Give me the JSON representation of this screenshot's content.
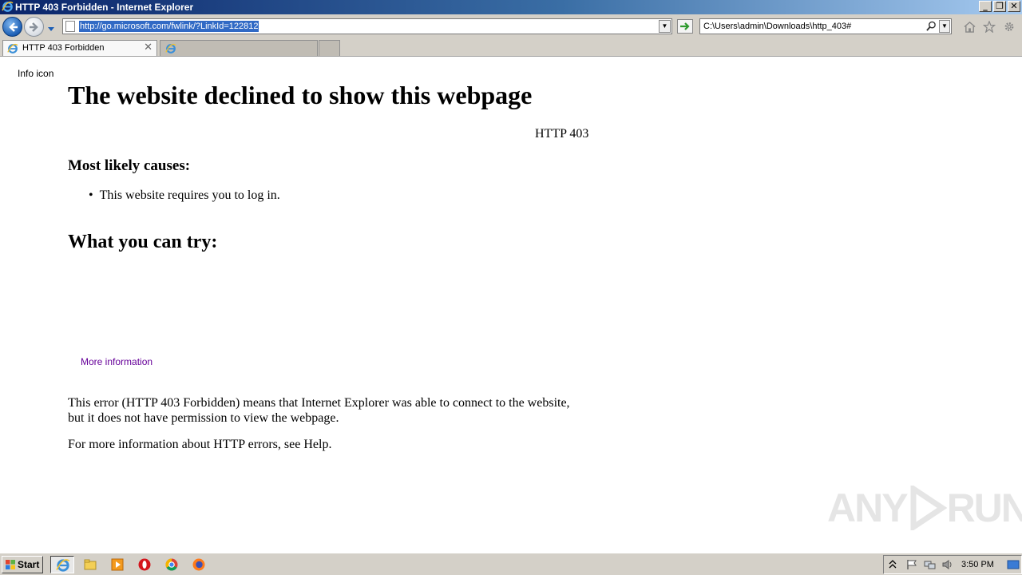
{
  "window": {
    "title": "HTTP 403 Forbidden - Internet Explorer",
    "controls": {
      "minimize": "_",
      "maximize": "❐",
      "close": "✕"
    }
  },
  "nav": {
    "url": "http://go.microsoft.com/fwlink/?LinkId=122812",
    "search_value": "C:\\Users\\admin\\Downloads\\http_403#"
  },
  "tabs": [
    {
      "label": "HTTP 403 Forbidden",
      "close": "✕"
    }
  ],
  "page": {
    "info_icon_alt": "Info icon",
    "heading": "The website declined to show this webpage",
    "http_code": "HTTP 403",
    "causes_heading": "Most likely causes:",
    "causes": [
      "This website requires you to log in."
    ],
    "try_heading": "What you can try:",
    "more_info_link": "More information",
    "explanation": "This error (HTTP 403 Forbidden) means that Internet Explorer was able to connect to the website, but it does not have permission to view the webpage.",
    "help_text": "For more information about HTTP errors, see Help."
  },
  "watermark": {
    "left": "ANY",
    "right": "RUN"
  },
  "taskbar": {
    "start_label": "Start",
    "clock": "3:50 PM"
  },
  "colors": {
    "url_highlight": "#316ac5",
    "visited_link": "#660099",
    "chrome_gray": "#d4d0c8"
  }
}
